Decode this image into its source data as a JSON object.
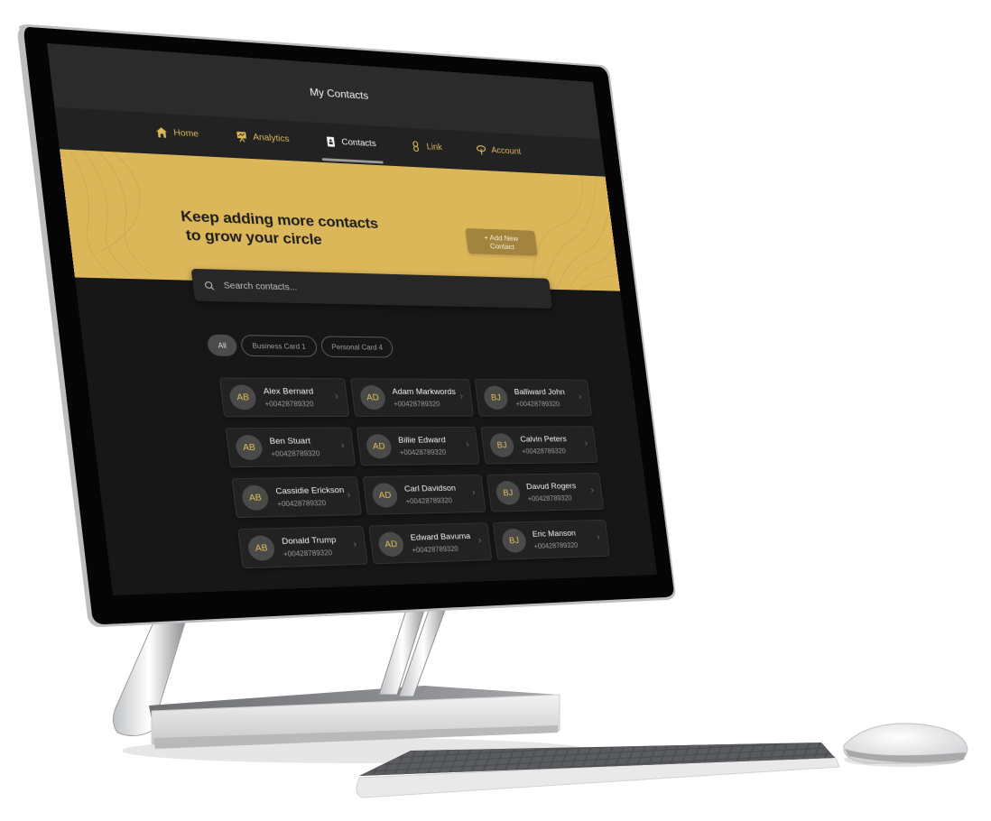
{
  "app": {
    "title": "My Contacts"
  },
  "nav": {
    "items": [
      {
        "label": "Home",
        "icon": "home-icon",
        "active": false
      },
      {
        "label": "Analytics",
        "icon": "analytics-icon",
        "active": false
      },
      {
        "label": "Contacts",
        "icon": "contacts-icon",
        "active": true
      },
      {
        "label": "Link",
        "icon": "link-icon",
        "active": false
      },
      {
        "label": "Account",
        "icon": "account-icon",
        "active": false
      }
    ]
  },
  "hero": {
    "title_line1": "Keep adding more contacts",
    "title_line2": "to grow your circle",
    "add_button": "+ Add New Contact"
  },
  "search": {
    "placeholder": "Search contacts...",
    "value": ""
  },
  "filters": [
    {
      "label": "All",
      "active": true
    },
    {
      "label": "Business Card 1",
      "active": false
    },
    {
      "label": "Personal Card 4",
      "active": false
    }
  ],
  "contacts": [
    {
      "initials": "AB",
      "name": "Alex Bernard",
      "phone": "+00428789320"
    },
    {
      "initials": "AD",
      "name": "Adam Markwords",
      "phone": "+00428789320"
    },
    {
      "initials": "BJ",
      "name": "Balliward John",
      "phone": "+00428789320"
    },
    {
      "initials": "AB",
      "name": "Ben Stuart",
      "phone": "+00428789320"
    },
    {
      "initials": "AD",
      "name": "Billie Edward",
      "phone": "+00428789320"
    },
    {
      "initials": "BJ",
      "name": "Calvin Peters",
      "phone": "+00428789320"
    },
    {
      "initials": "AB",
      "name": "Cassidie Erickson",
      "phone": "+00428789320"
    },
    {
      "initials": "AD",
      "name": "Carl Davidson",
      "phone": "+00428789320"
    },
    {
      "initials": "BJ",
      "name": "Davud Rogers",
      "phone": "+00428789320"
    },
    {
      "initials": "AB",
      "name": "Donald Trump",
      "phone": "+00428789320"
    },
    {
      "initials": "AD",
      "name": "Edward Bavuma",
      "phone": "+00428789320"
    },
    {
      "initials": "BJ",
      "name": "Eric Manson",
      "phone": "+00428789320"
    }
  ],
  "colors": {
    "accent": "#dcb75a",
    "button": "#a3843e",
    "background": "#171717",
    "titlebar": "#2b2b2b",
    "navbar": "#222222"
  }
}
